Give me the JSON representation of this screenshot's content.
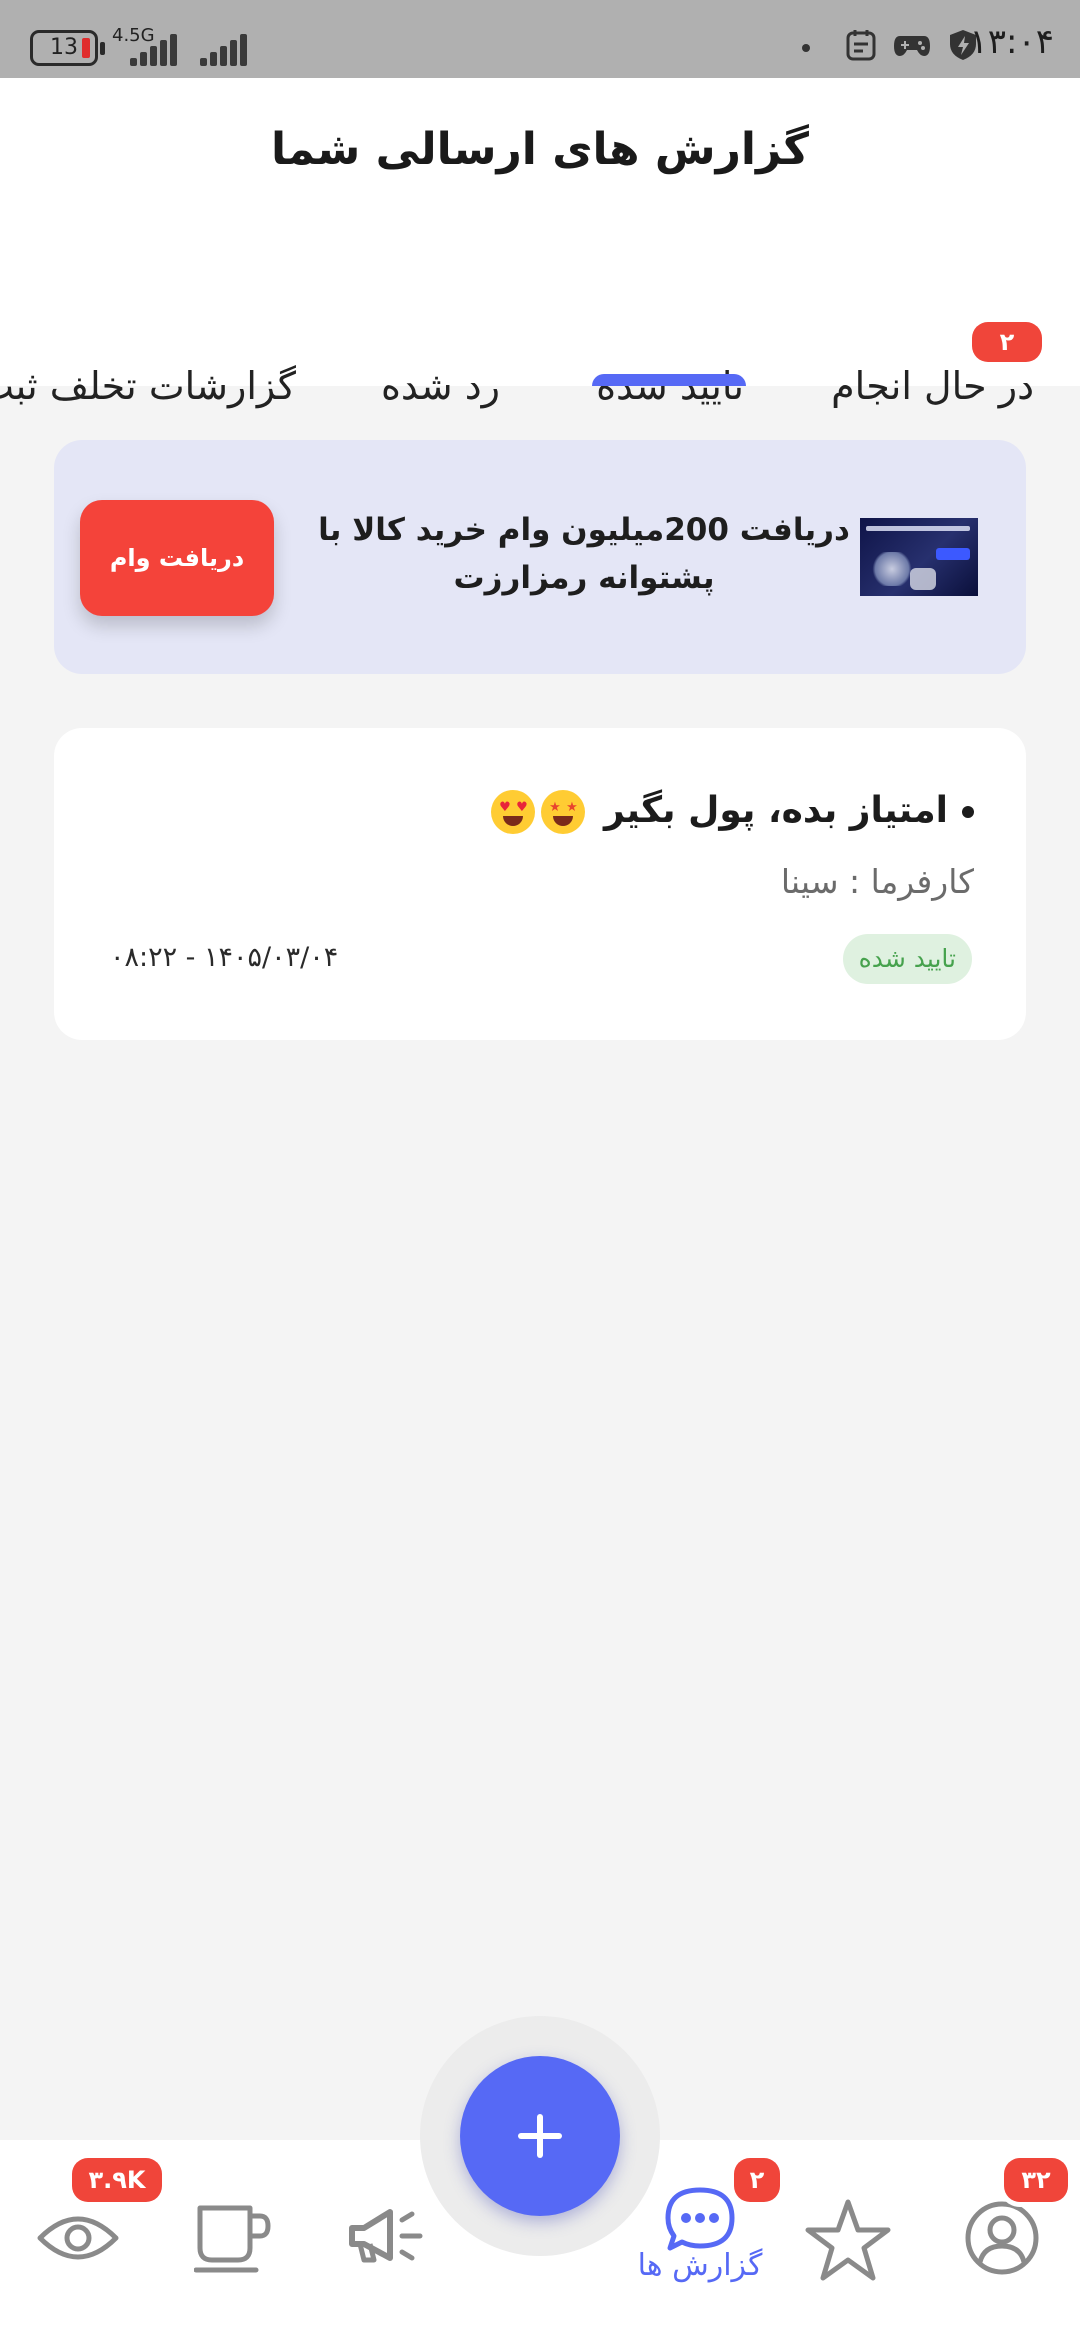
{
  "status_bar": {
    "time": "۱۳:۰۴",
    "battery": "13",
    "network": "4.5G"
  },
  "header": {
    "title": "گزارش های ارسالی شما"
  },
  "tabs": [
    {
      "label": "در حال انجام",
      "badge": "۲"
    },
    {
      "label": "تایید شده",
      "active": true
    },
    {
      "label": "رد شده"
    },
    {
      "label": "گزارشات تخلف ثبت"
    }
  ],
  "banner": {
    "text_line1": "دریافت 200میلیون وام خرید کالا با",
    "text_line2": "پشتوانه رمزارزت",
    "button_label": "دریافت وام"
  },
  "report": {
    "title": "امتیاز بده، پول بگیر",
    "employer": "کارفرما : سینا",
    "status": "تایید شده",
    "date": "۰۸:۲۲ - ۱۴۰۵/۰۳/۰۴"
  },
  "bottom_nav": {
    "views_badge": "۳.۹K",
    "reports_label": "گزارش ها",
    "reports_badge": "۲",
    "profile_badge": "۳۲"
  },
  "colors": {
    "accent": "#5669f5",
    "badge": "#f0453a",
    "status_green": "#46a24d"
  }
}
